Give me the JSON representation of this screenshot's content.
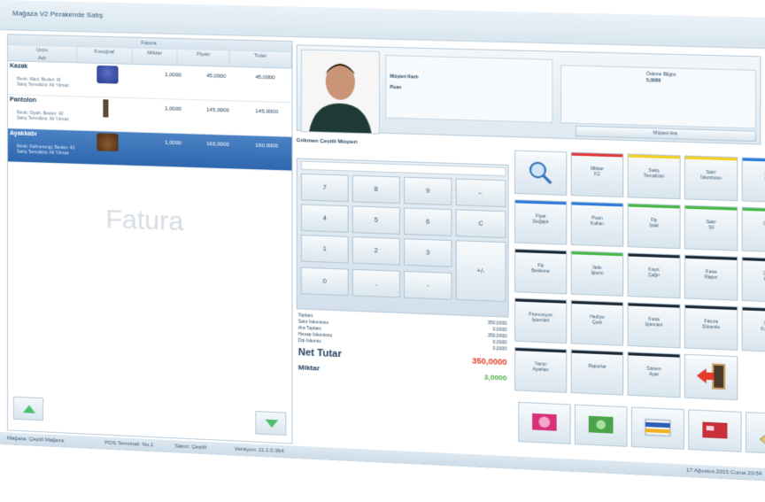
{
  "window": {
    "title": "Mağaza V2 Perakende Satış"
  },
  "table": {
    "group_header": "Fatura",
    "columns": [
      "Ürün\nAdı",
      "Fotoğraf",
      "Miktar",
      "Fiyatı",
      "Tutar"
    ],
    "rows": [
      {
        "name": "Kazak",
        "sub": "Renk: Mavi, Beden: M\nSatış Temsilcisi: Ali Yılmaz",
        "qty": "1,0000",
        "price": "45,0000",
        "total": "45,0000",
        "selected": false
      },
      {
        "name": "Pantolon",
        "sub": "Renk: Siyah, Beden: 42\nSatış Temsilcisi: Ali Yılmaz",
        "qty": "1,0000",
        "price": "145,0000",
        "total": "145,0000",
        "selected": false
      },
      {
        "name": "Ayakkabı",
        "sub": "Renk: Kahverengi, Beden: 43\nSatış Temsilcisi: Ali Yılmaz",
        "qty": "1,0000",
        "price": "160,0000",
        "total": "160,0000",
        "selected": true
      }
    ],
    "watermark": "Fatura"
  },
  "customer": {
    "name": "Gökmen Çeşitli Müşteri",
    "id_label": "Müşteri Kartı",
    "points_label": "Puan",
    "box2_title": "Ödeme Bilgisi",
    "box2_value": "5,0000",
    "find_button": "Müşteri Ara"
  },
  "numpad": {
    "keys": [
      "7",
      "8",
      "9",
      "←",
      "4",
      "5",
      "6",
      "C",
      "1",
      "2",
      "3",
      "0",
      ",",
      "-",
      "+/-"
    ]
  },
  "totals": {
    "lines": [
      {
        "label": "Toplam",
        "value": "350,0000"
      },
      {
        "label": "Satır İskontosu",
        "value": "0,0000"
      },
      {
        "label": "Ara Toplam",
        "value": "350,0000"
      },
      {
        "label": "Hesap İskontosu",
        "value": "0,0000"
      },
      {
        "label": "Dip İskonto",
        "value": "0,0000"
      }
    ],
    "net_label": "Net Tutar",
    "net_value": "350,0000",
    "qty_label": "Miktar",
    "qty_value": "3,0000"
  },
  "functions": [
    {
      "label": "Ara",
      "color": "#ffffff",
      "icon": "search-icon"
    },
    {
      "label": "Miktar\nF2",
      "color": "#e23b3b"
    },
    {
      "label": "Satış\nTemsilcisi",
      "color": "#f2d024"
    },
    {
      "label": "Satır\nİskontosu",
      "color": "#f2d024"
    },
    {
      "label": "Dip\nİsk.",
      "color": "#2f7bd9"
    },
    {
      "label": "Fiyat\nDeğiştir",
      "color": "#2f7bd9"
    },
    {
      "label": "Puan\nKullan",
      "color": "#2f7bd9"
    },
    {
      "label": "Fiş\nİptal",
      "color": "#49b848"
    },
    {
      "label": "Satır\nSil",
      "color": "#49b848"
    },
    {
      "label": "Ürün\nBul",
      "color": "#49b848"
    },
    {
      "label": "Fiş\nBekleme",
      "color": "#1e2a35"
    },
    {
      "label": "İade\nİşlemi",
      "color": "#49b848"
    },
    {
      "label": "Kayıt\nÇağır",
      "color": "#1e2a35"
    },
    {
      "label": "Kasa\nRapor",
      "color": "#1e2a35"
    },
    {
      "label": "Ürün\nBilgi",
      "color": "#1e2a35"
    },
    {
      "label": "Promosyon\nİşlemleri",
      "color": "#1e2a35"
    },
    {
      "label": "Hediye\nÇeki",
      "color": "#1e2a35"
    },
    {
      "label": "Kasa\nİşlemleri",
      "color": "#1e2a35"
    },
    {
      "label": "Fatura\nDüzenle",
      "color": "#1e2a35"
    },
    {
      "label": "Stok\nKontrol",
      "color": "#1e2a35"
    },
    {
      "label": "Yazıcı\nAyarları",
      "color": "#1e2a35"
    },
    {
      "label": "Raporlar",
      "color": "#1e2a35"
    },
    {
      "label": "Sistem\nAyar",
      "color": "#1e2a35"
    },
    {
      "label": "Çıkış",
      "color": "#ffffff",
      "icon": "exit-icon"
    }
  ],
  "payments": [
    "Nakit",
    "Banknot",
    "Kredi Kartı",
    "Kart",
    "Çek"
  ],
  "status": {
    "store": "Mağaza: Çeşitli Mağaza",
    "terminal": "POS Terminali: No.1",
    "cashier": "Satıcı: Çeşitli",
    "version": "Versiyon: 11.1.0.364",
    "date": "17 Ağustos 2015 Cuma 20:54"
  }
}
